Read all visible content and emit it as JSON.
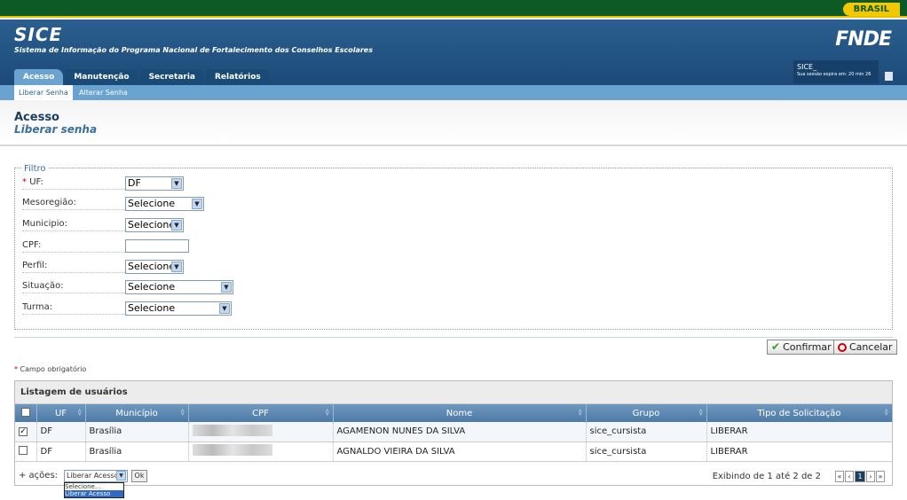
{
  "gov": {
    "brand": "BRASIL"
  },
  "header": {
    "title": "SICE",
    "subtitle": "Sistema de Informação do Programa Nacional de Fortalecimento dos Conselhos Escolares",
    "logo": "FNDE",
    "session_user": "SICE_",
    "session_expiry": "Sua sessão expira em: 20 min 26"
  },
  "tabs": [
    "Acesso",
    "Manutenção",
    "Secretaria",
    "Relatórios"
  ],
  "subtabs": [
    "Liberar Senha",
    "Alterar Senha"
  ],
  "page": {
    "title": "Acesso",
    "subtitle": "Liberar senha"
  },
  "filter": {
    "legend": "Filtro",
    "required_mark": "*",
    "fields": [
      {
        "label": "UF:",
        "value": "DF"
      },
      {
        "label": "Mesoregião:",
        "value": "Selecione"
      },
      {
        "label": "Municipio:",
        "value": "Selecione"
      },
      {
        "label": "CPF:",
        "value": ""
      },
      {
        "label": "Perfil:",
        "value": "Selecione"
      },
      {
        "label": "Situação:",
        "value": "Selecione"
      },
      {
        "label": "Turma:",
        "value": "Selecione"
      }
    ]
  },
  "buttons": {
    "confirm": "Confirmar",
    "cancel": "Cancelar"
  },
  "required_note": "Campo obrigatório",
  "grid": {
    "title": "Listagem de usuários",
    "columns": [
      "UF",
      "Município",
      "CPF",
      "Nome",
      "Grupo",
      "Tipo de Solicitação"
    ],
    "rows": [
      {
        "checked": true,
        "uf": "DF",
        "municipio": "Brasília",
        "nome": "AGAMENON NUNES DA SILVA",
        "grupo": "sice_cursista",
        "tipo": "LIBERAR"
      },
      {
        "checked": false,
        "uf": "DF",
        "municipio": "Brasília",
        "nome": "AGNALDO VIEIRA DA SILVA",
        "grupo": "sice_cursista",
        "tipo": "LIBERAR"
      }
    ]
  },
  "footer": {
    "acoes_label": "+ ações:",
    "acoes_value": "Liberar Acesso",
    "ok": "Ok",
    "dropdown_options": [
      "Selecione...",
      "Liberar Acesso"
    ],
    "info": "Exibindo de 1 até 2 de 2",
    "pager": [
      "«",
      "‹",
      "1",
      "›",
      "»"
    ]
  }
}
